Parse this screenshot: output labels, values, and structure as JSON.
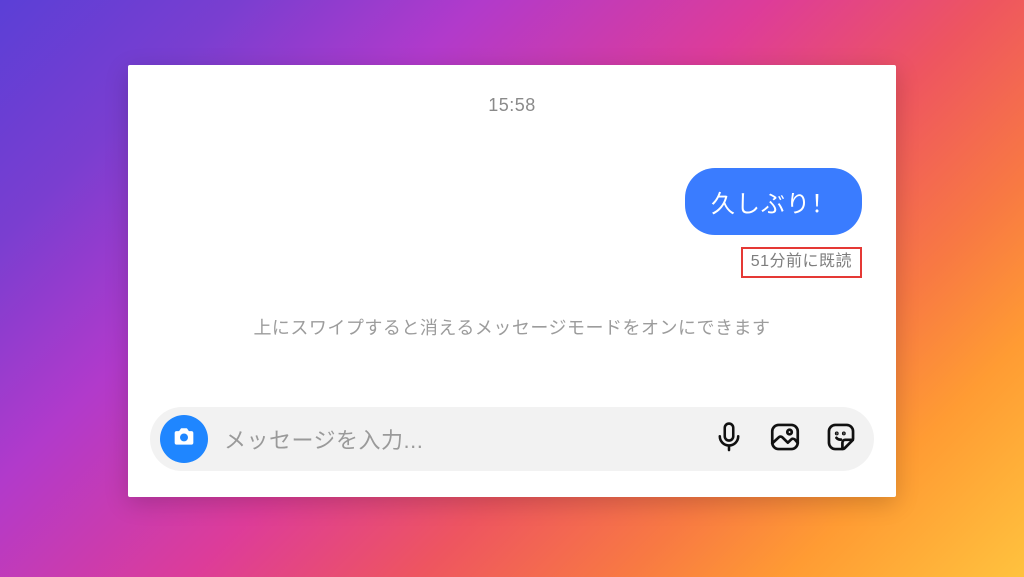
{
  "chat": {
    "timestamp": "15:58",
    "message": "久しぶり！",
    "read_receipt": "51分前に既読",
    "hint": "上にスワイプすると消えるメッセージモードをオンにできます"
  },
  "composer": {
    "placeholder": "メッセージを入力..."
  },
  "icons": {
    "camera": "camera-icon",
    "mic": "microphone-icon",
    "gallery": "gallery-icon",
    "sticker": "sticker-icon"
  },
  "colors": {
    "bubble": "#3a7cff",
    "highlight_border": "#e53935",
    "camera_button": "#1f86ff"
  }
}
